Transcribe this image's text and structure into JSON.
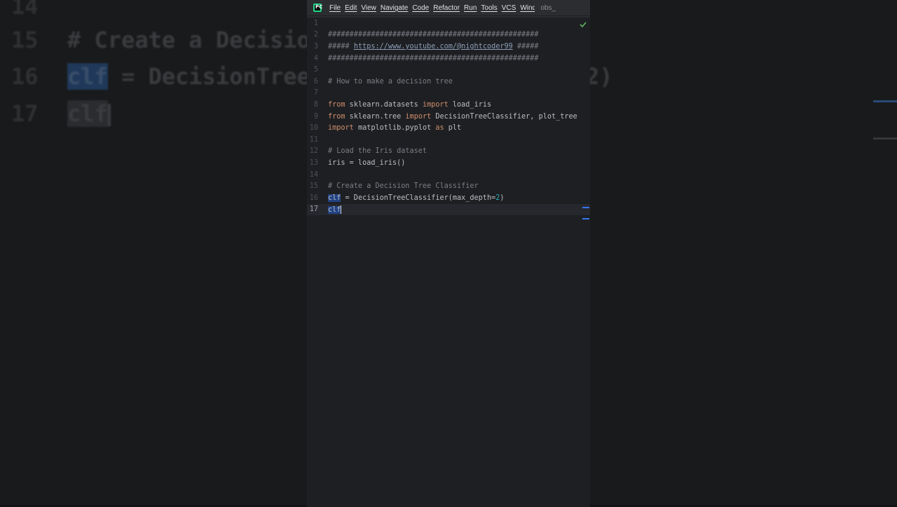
{
  "menubar": {
    "items": [
      "File",
      "Edit",
      "View",
      "Navigate",
      "Code",
      "Refactor",
      "Run",
      "Tools",
      "VCS",
      "Wind"
    ],
    "project_label": "obs_"
  },
  "editor": {
    "lines": [
      {
        "n": "1",
        "parts": []
      },
      {
        "n": "2",
        "parts": [
          {
            "t": "comment",
            "v": "#################################################"
          }
        ]
      },
      {
        "n": "3",
        "parts": [
          {
            "t": "comment",
            "v": "##### "
          },
          {
            "t": "link",
            "v": "https://www.youtube.com/@nightcoder99"
          },
          {
            "t": "comment",
            "v": " #####"
          }
        ]
      },
      {
        "n": "4",
        "parts": [
          {
            "t": "comment",
            "v": "#################################################"
          }
        ]
      },
      {
        "n": "5",
        "parts": []
      },
      {
        "n": "6",
        "parts": [
          {
            "t": "comment",
            "v": "# How to make a decision tree"
          }
        ]
      },
      {
        "n": "7",
        "parts": []
      },
      {
        "n": "8",
        "parts": [
          {
            "t": "kw",
            "v": "from"
          },
          {
            "t": "plain",
            "v": " sklearn.datasets "
          },
          {
            "t": "kw",
            "v": "import"
          },
          {
            "t": "plain",
            "v": " load_iris"
          }
        ]
      },
      {
        "n": "9",
        "parts": [
          {
            "t": "kw",
            "v": "from"
          },
          {
            "t": "plain",
            "v": " sklearn.tree "
          },
          {
            "t": "kw",
            "v": "import"
          },
          {
            "t": "plain",
            "v": " DecisionTreeClassifier, plot_tree"
          }
        ]
      },
      {
        "n": "10",
        "parts": [
          {
            "t": "kw",
            "v": "import"
          },
          {
            "t": "plain",
            "v": " matplotlib.pyplot "
          },
          {
            "t": "kw",
            "v": "as"
          },
          {
            "t": "plain",
            "v": " plt"
          }
        ]
      },
      {
        "n": "11",
        "parts": []
      },
      {
        "n": "12",
        "parts": [
          {
            "t": "comment",
            "v": "# Load the Iris dataset"
          }
        ]
      },
      {
        "n": "13",
        "parts": [
          {
            "t": "plain",
            "v": "iris = load_iris()"
          }
        ]
      },
      {
        "n": "14",
        "parts": []
      },
      {
        "n": "15",
        "parts": [
          {
            "t": "comment",
            "v": "# Create a Decision Tree Classifier"
          }
        ]
      },
      {
        "n": "16",
        "parts": [
          {
            "t": "sel",
            "v": "clf"
          },
          {
            "t": "plain",
            "v": " = DecisionTreeClassifier(max_depth="
          },
          {
            "t": "num",
            "v": "2"
          },
          {
            "t": "plain",
            "v": ")"
          }
        ]
      },
      {
        "n": "17",
        "parts": [
          {
            "t": "sel",
            "v": "clf"
          },
          {
            "t": "caret",
            "v": ""
          }
        ],
        "current": true
      }
    ]
  },
  "background": {
    "lines": [
      {
        "n": "14",
        "text": ""
      },
      {
        "n": "15",
        "text": "# Create a Decisio"
      },
      {
        "n": "16",
        "sel": "clf",
        "text": " = DecisionTree"
      },
      {
        "n": "17",
        "sel": "clf",
        "text": ""
      }
    ],
    "right_fragment": "2)"
  },
  "colors": {
    "accent": "#3574f0",
    "keyword": "#cf8e6d",
    "comment": "#7a7e85",
    "selection": "#214283"
  }
}
